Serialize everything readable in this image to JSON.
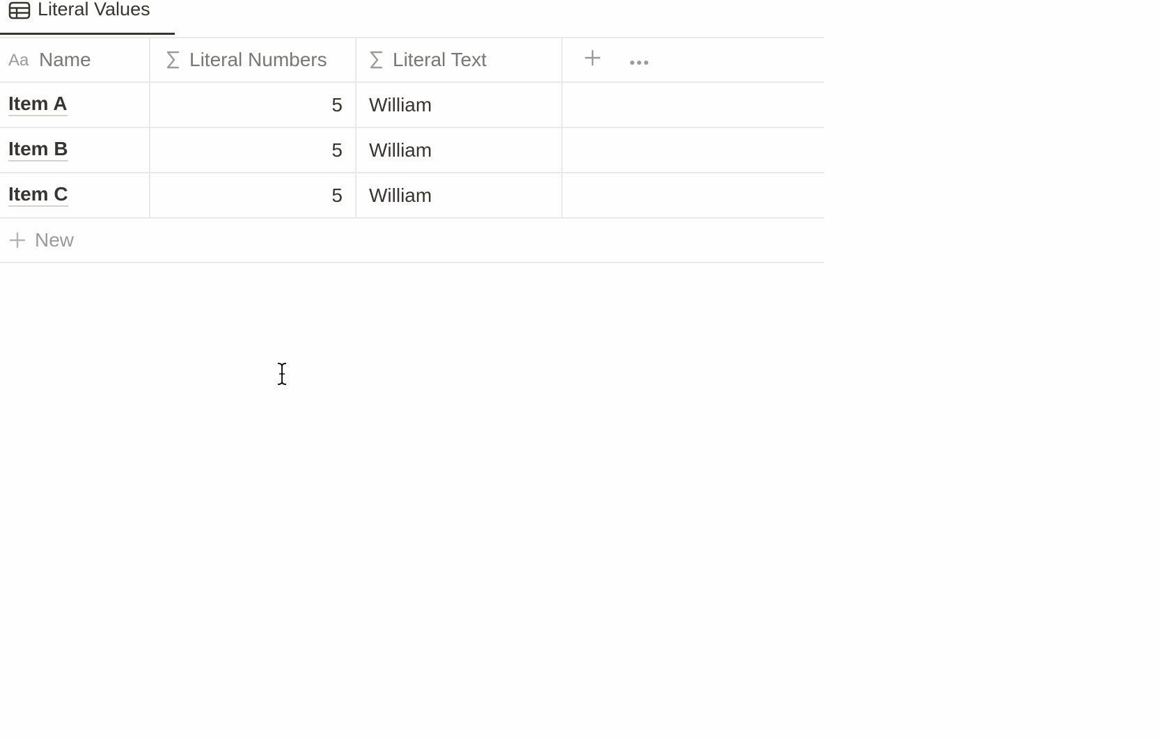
{
  "view": {
    "title": "Literal Values",
    "icon": "table-icon"
  },
  "table": {
    "columns": [
      {
        "label": "Name",
        "icon": "aa-text-icon"
      },
      {
        "label": "Literal Numbers",
        "icon": "sigma-formula-icon"
      },
      {
        "label": "Literal Text",
        "icon": "sigma-formula-icon"
      }
    ],
    "rows": [
      {
        "name": "Item A",
        "number": "5",
        "text": "William"
      },
      {
        "name": "Item B",
        "number": "5",
        "text": "William"
      },
      {
        "name": "Item C",
        "number": "5",
        "text": "William"
      }
    ],
    "new_label": "New"
  },
  "icons": {
    "add_property": "plus-icon",
    "more": "ellipsis-icon",
    "cursor": "text-cursor-icon"
  }
}
